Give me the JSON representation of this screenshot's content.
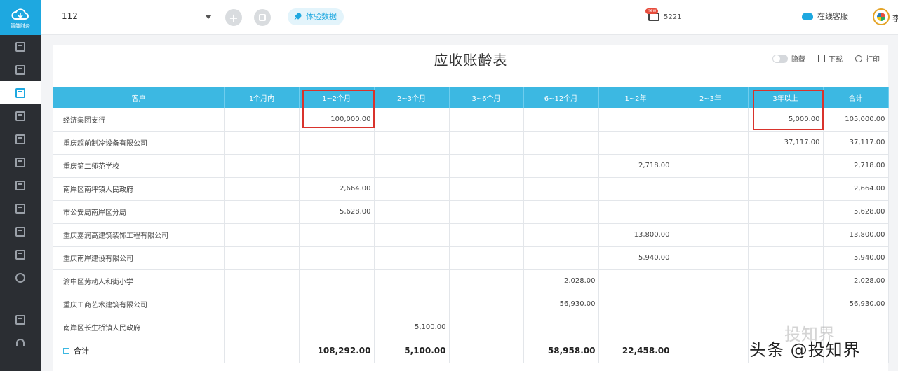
{
  "app": {
    "logo_text": "智能财务",
    "company": "112",
    "trial_label": "体验数据",
    "message_badge": "new",
    "message_count": "5221",
    "service_label": "在线客服",
    "user_char": "李"
  },
  "sidebar": {
    "active_index": 2
  },
  "report": {
    "title": "应收账龄表",
    "tools": {
      "toggle_label": "隐藏",
      "download_label": "下载",
      "print_label": "打印"
    },
    "columns": [
      "客户",
      "1个月内",
      "1~2个月",
      "2~3个月",
      "3~6个月",
      "6~12个月",
      "1~2年",
      "2~3年",
      "3年以上",
      "合计"
    ],
    "rows": [
      [
        "经济集团支行",
        "",
        "100,000.00",
        "",
        "",
        "",
        "",
        "",
        "5,000.00",
        "105,000.00"
      ],
      [
        "重庆超前制冷设备有限公司",
        "",
        "",
        "",
        "",
        "",
        "",
        "",
        "37,117.00",
        "37,117.00"
      ],
      [
        "重庆第二师范学校",
        "",
        "",
        "",
        "",
        "",
        "2,718.00",
        "",
        "",
        "2,718.00"
      ],
      [
        "南岸区南坪镇人民政府",
        "",
        "2,664.00",
        "",
        "",
        "",
        "",
        "",
        "",
        "2,664.00"
      ],
      [
        "市公安局南岸区分局",
        "",
        "5,628.00",
        "",
        "",
        "",
        "",
        "",
        "",
        "5,628.00"
      ],
      [
        "重庆嘉润高建筑装饰工程有限公司",
        "",
        "",
        "",
        "",
        "",
        "13,800.00",
        "",
        "",
        "13,800.00"
      ],
      [
        "重庆南岸建设有限公司",
        "",
        "",
        "",
        "",
        "",
        "5,940.00",
        "",
        "",
        "5,940.00"
      ],
      [
        "渝中区劳动人和街小学",
        "",
        "",
        "",
        "",
        "2,028.00",
        "",
        "",
        "",
        "2,028.00"
      ],
      [
        "重庆工商艺术建筑有限公司",
        "",
        "",
        "",
        "",
        "56,930.00",
        "",
        "",
        "",
        "56,930.00"
      ],
      [
        "南岸区长生桥镇人民政府",
        "",
        "",
        "5,100.00",
        "",
        "",
        "",
        "",
        "",
        ""
      ]
    ],
    "total": {
      "label": "合计",
      "values": [
        "",
        "108,292.00",
        "5,100.00",
        "",
        "58,958.00",
        "22,458.00",
        "",
        "",
        ""
      ]
    }
  },
  "watermark": {
    "text": "头条 @投知界",
    "faint_text": "投知界"
  },
  "colors": {
    "accent": "#1ea8e0",
    "header_bg": "#3cb8e2",
    "highlight": "#d9332c",
    "sidebar_bg": "#2b2e33"
  }
}
